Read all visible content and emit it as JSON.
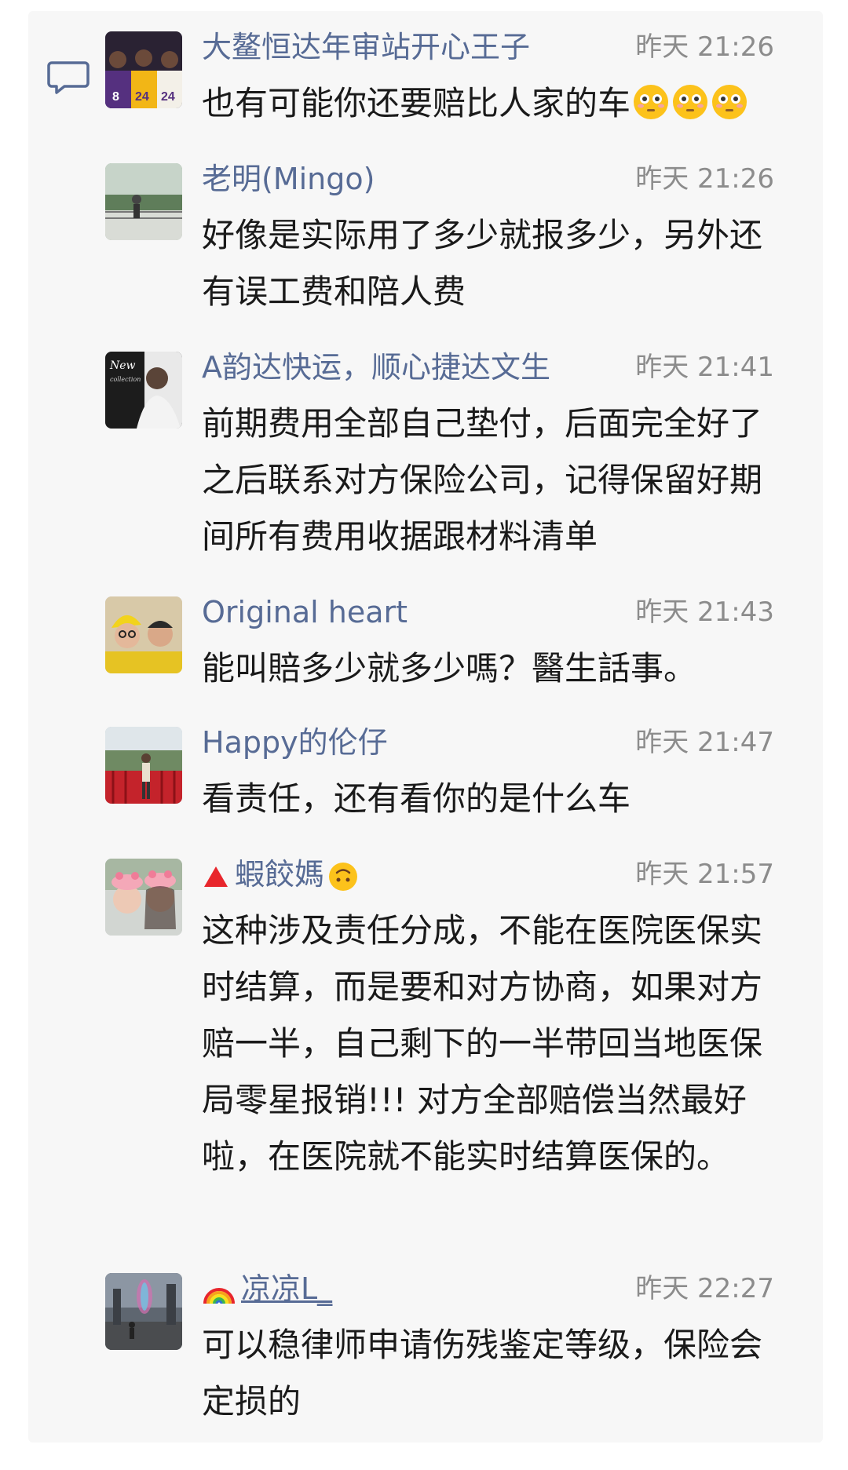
{
  "comments": [
    {
      "name": "大鳌恒达年审站开心王子",
      "time": "昨天 21:26",
      "text": "也有可能你还要赔比人家的车",
      "emoji_name": "flushed-face-icon",
      "emoji_count": 3
    },
    {
      "name": "老明(Mingo)",
      "time": "昨天 21:26",
      "text": "好像是实际用了多少就报多少，另外还有误工费和陪人费"
    },
    {
      "name": "A韵达快运，顺心捷达文生",
      "time": "昨天 21:41",
      "text": "前期费用全部自己垫付，后面完全好了之后联系对方保险公司，记得保留好期间所有费用收据跟材料清单"
    },
    {
      "name": "Original  heart",
      "time": "昨天 21:43",
      "text": "能叫賠多少就多少嗎？醫生話事。"
    },
    {
      "name": "Happy的伦仔",
      "time": "昨天 21:47",
      "text": "看责任，还有看你的是什么车"
    },
    {
      "name_prefix_icon": "red-triangle-icon",
      "name": "蝦餃媽",
      "name_suffix_icon": "upside-down-face-icon",
      "time": "昨天 21:57",
      "text": "这种涉及责任分成，不能在医院医保实时结算，而是要和对方协商，如果对方赔一半，自己剩下的一半带回当地医保局零星报销!!! 对方全部赔偿当然最好啦，在医院就不能实时结算医保的。"
    },
    {
      "name_prefix_icon": "rainbow-icon",
      "name": "凉凉L_",
      "time": "昨天 22:27",
      "text": "可以稳律师申请伤残鉴定等级，保险会定损的"
    }
  ],
  "colors": {
    "nickname": "#576b95",
    "time": "#8c8c8c",
    "text": "#1a1a1a",
    "panel": "#f7f7f7"
  }
}
